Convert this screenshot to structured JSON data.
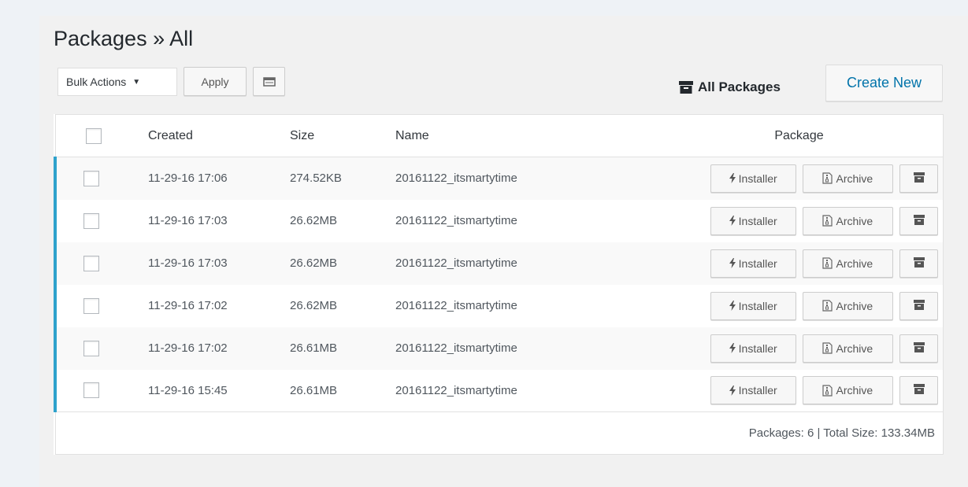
{
  "page": {
    "title": "Packages » All"
  },
  "toolbar": {
    "bulk_actions_label": "Bulk Actions",
    "apply_label": "Apply",
    "all_packages_label": "All Packages",
    "create_new_label": "Create New"
  },
  "table": {
    "headers": {
      "created": "Created",
      "size": "Size",
      "name": "Name",
      "package": "Package"
    },
    "button_labels": {
      "installer": "Installer",
      "archive": "Archive"
    },
    "rows": [
      {
        "created": "11-29-16 17:06",
        "size": "274.52KB",
        "name": "20161122_itsmartytime"
      },
      {
        "created": "11-29-16 17:03",
        "size": "26.62MB",
        "name": "20161122_itsmartytime"
      },
      {
        "created": "11-29-16 17:03",
        "size": "26.62MB",
        "name": "20161122_itsmartytime"
      },
      {
        "created": "11-29-16 17:02",
        "size": "26.62MB",
        "name": "20161122_itsmartytime"
      },
      {
        "created": "11-29-16 17:02",
        "size": "26.61MB",
        "name": "20161122_itsmartytime"
      },
      {
        "created": "11-29-16 15:45",
        "size": "26.61MB",
        "name": "20161122_itsmartytime"
      }
    ],
    "footer": "Packages: 6 | Total Size: 133.34MB"
  },
  "icons": {
    "columns": "columns-icon",
    "all_packages": "archive-box-icon",
    "installer": "bolt-icon",
    "archive": "file-archive-icon",
    "remove": "archive-box-icon"
  },
  "colors": {
    "accent": "#0073aa",
    "row_marker": "#2ea2cc"
  }
}
